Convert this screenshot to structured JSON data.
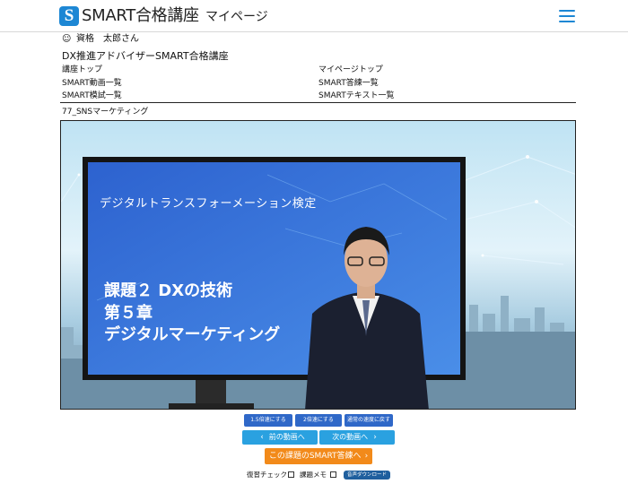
{
  "header": {
    "logo_letter": "S",
    "logo_text": "SMART合格講座",
    "subtitle": "マイページ",
    "menu_icon": "hamburger-menu-icon"
  },
  "user": {
    "icon": "smiley-face-icon",
    "name": "資格　太郎さん"
  },
  "course": {
    "title": "DX推進アドバイザーSMART合格講座"
  },
  "nav_links": {
    "course_top": "講座トップ",
    "my_page_top": "マイページトップ",
    "video_list": "SMART動画一覧",
    "practice_list": "SMART答練一覧",
    "mock_exam_list": "SMART模試一覧",
    "text_list": "SMARTテキスト一覧"
  },
  "video": {
    "title": "77_SNSマーケティング",
    "slide_heading": "デジタルトランスフォーメーション検定",
    "slide_line1": "課題２ DXの技術",
    "slide_line2": "第５章",
    "slide_line3": "デジタルマーケティング"
  },
  "speed_buttons": {
    "x15": "1.5倍速にする",
    "x2": "2倍速にする",
    "normal": "通常の速度に戻す"
  },
  "navigation": {
    "prev": "前の動画へ",
    "next": "次の動画へ",
    "prev_icon": "chevron-left-icon",
    "next_icon": "chevron-right-icon"
  },
  "practice_button": "この課題のSMART答練へ",
  "review": {
    "review_check": "復習チェック",
    "task_memo": "課題メモ",
    "audio_download": "音声ダウンロード"
  },
  "colors": {
    "brand_blue": "#1d87d4",
    "speed_button": "#2f68c8",
    "nav_button": "#2aa1e0",
    "practice_button": "#f28a1a",
    "audio_button": "#1f5f9e"
  }
}
